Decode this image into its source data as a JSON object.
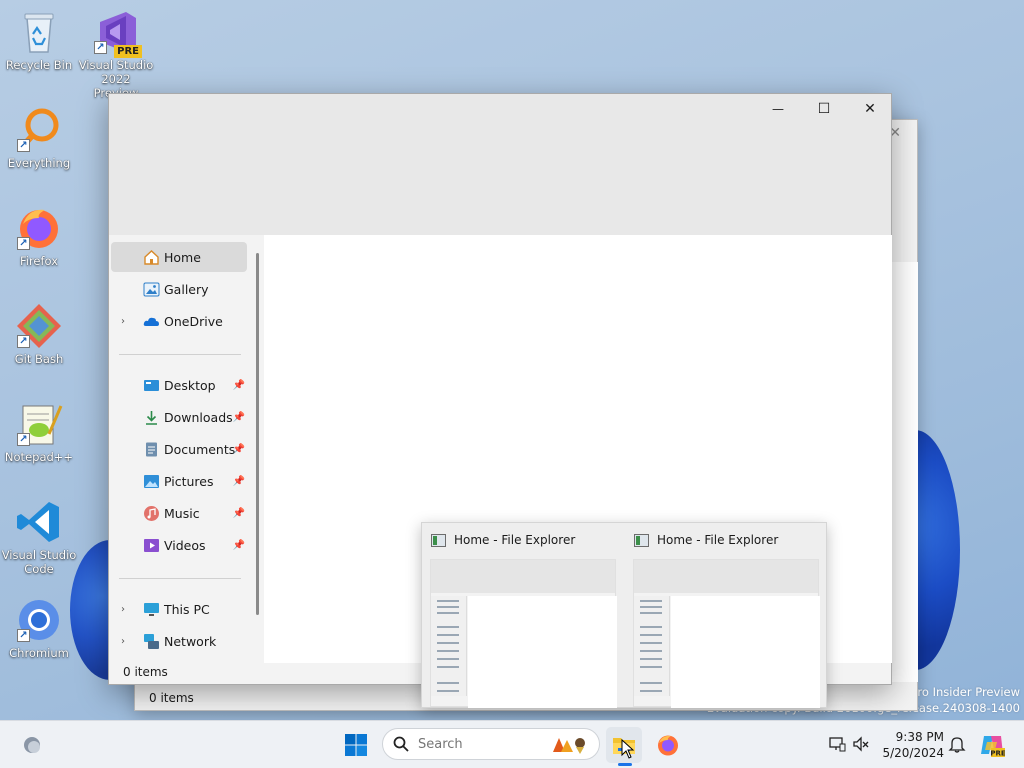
{
  "desktop": {
    "icons": [
      {
        "label": "Recycle Bin",
        "icon": "recycle-bin-icon"
      },
      {
        "label": "Visual Studio 2022 Preview",
        "badge": "PRE",
        "icon": "visual-studio-preview-icon"
      },
      {
        "label": "Everything",
        "icon": "everything-search-icon"
      },
      {
        "label": "Firefox",
        "icon": "firefox-icon"
      },
      {
        "label": "Git Bash",
        "icon": "git-bash-icon"
      },
      {
        "label": "Notepad++",
        "icon": "notepad-plus-plus-icon"
      },
      {
        "label": "Visual Studio Code",
        "icon": "vscode-icon"
      },
      {
        "label": "Chromium",
        "icon": "chromium-icon"
      }
    ],
    "watermark": {
      "line1": "Pro Insider Preview",
      "line2": "Evaluation copy. Build 26100.ge_release.240308-1400"
    }
  },
  "explorer_back": {
    "status": "0 items"
  },
  "explorer": {
    "caption": {
      "minimize": "—",
      "maximize": "☐",
      "close": "✕"
    },
    "nav": {
      "top": [
        {
          "label": "Home",
          "icon": "home-icon",
          "selected": true
        },
        {
          "label": "Gallery",
          "icon": "gallery-icon"
        },
        {
          "label": "OneDrive",
          "icon": "onedrive-icon",
          "expandable": true
        }
      ],
      "quick_access": [
        {
          "label": "Desktop",
          "icon": "desktop-folder-icon"
        },
        {
          "label": "Downloads",
          "icon": "downloads-icon"
        },
        {
          "label": "Documents",
          "icon": "documents-icon"
        },
        {
          "label": "Pictures",
          "icon": "pictures-icon"
        },
        {
          "label": "Music",
          "icon": "music-icon"
        },
        {
          "label": "Videos",
          "icon": "videos-icon"
        }
      ],
      "bottom": [
        {
          "label": "This PC",
          "icon": "this-pc-icon"
        },
        {
          "label": "Network",
          "icon": "network-icon"
        }
      ]
    },
    "status": "0 items"
  },
  "thumbnails": [
    {
      "title": "Home - File Explorer"
    },
    {
      "title": "Home - File Explorer"
    }
  ],
  "taskbar": {
    "search_placeholder": "Search",
    "time": "9:38 PM",
    "date": "5/20/2024",
    "colors": {
      "accent": "#1a73e8",
      "start_blue": "#0067c0"
    }
  }
}
